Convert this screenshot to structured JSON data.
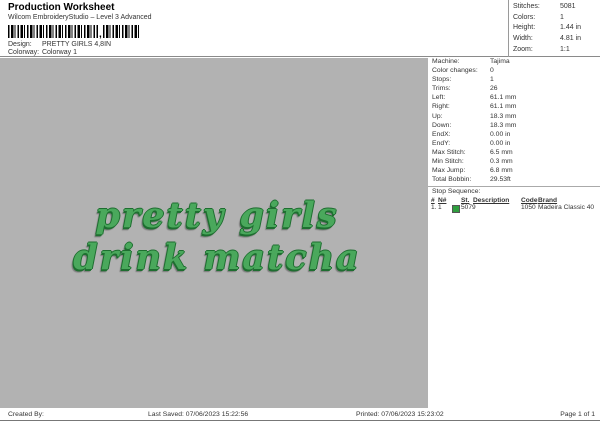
{
  "header": {
    "title": "Production Worksheet",
    "subtitle": "Wilcom EmbroideryStudio – Level 3 Advanced",
    "barcode_comma": ",",
    "design_label": "Design:",
    "design_value": "PRETTY GIRLS 4,8IN",
    "colorway_label": "Colorway:",
    "colorway_value": "Colorway 1"
  },
  "stats": {
    "rows": [
      {
        "label": "Stitches:",
        "value": "5081"
      },
      {
        "label": "Colors:",
        "value": "1"
      },
      {
        "label": "Height:",
        "value": "1.44 in"
      },
      {
        "label": "Width:",
        "value": "4.81 in"
      },
      {
        "label": "Zoom:",
        "value": "1:1"
      }
    ]
  },
  "machine_info": {
    "rows": [
      {
        "label": "Machine:",
        "value": "Tajima"
      },
      {
        "label": "Color changes:",
        "value": "0"
      },
      {
        "label": "Stops:",
        "value": "1"
      },
      {
        "label": "Trims:",
        "value": "26"
      },
      {
        "label": "Left:",
        "value": "61.1 mm"
      },
      {
        "label": "Right:",
        "value": "61.1 mm"
      },
      {
        "label": "Up:",
        "value": "18.3 mm"
      },
      {
        "label": "Down:",
        "value": "18.3 mm"
      },
      {
        "label": "EndX:",
        "value": "0.00 in"
      },
      {
        "label": "EndY:",
        "value": "0.00 in"
      },
      {
        "label": "Max Stitch:",
        "value": "6.5 mm"
      },
      {
        "label": "Min Stitch:",
        "value": "0.3 mm"
      },
      {
        "label": "Max Jump:",
        "value": "6.8 mm"
      },
      {
        "label": "Total Bobbin:",
        "value": "29.53ft"
      }
    ]
  },
  "stop_sequence": {
    "title": "Stop Sequence:",
    "columns": [
      "#",
      "N#",
      "St.",
      "Description",
      "Code",
      "Brand"
    ],
    "rows": [
      {
        "num": "1.",
        "n": "1",
        "st": "5079",
        "description": "",
        "code": "1050",
        "brand": "Madeira Classic 40",
        "swatch_color": "#2f9e3f"
      }
    ]
  },
  "canvas": {
    "background": "#b2b2b2",
    "thread_color": "#4aa85c",
    "outline_color": "#1e6e30",
    "line1": "pretty girls",
    "line2": "drink matcha"
  },
  "footer": {
    "created_by": "Created By:",
    "last_saved": "Last Saved: 07/06/2023 15:22:56",
    "printed": "Printed: 07/06/2023 15:23:02",
    "page": "Page 1 of 1"
  }
}
